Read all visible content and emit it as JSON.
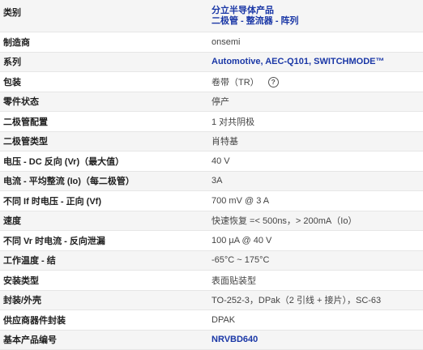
{
  "rows": [
    {
      "label": "类别",
      "value_lines": [
        "分立半导体产品",
        "二极管 - 整流器 - 阵列"
      ]
    },
    {
      "label": "制造商",
      "value": "onsemi"
    },
    {
      "label": "系列",
      "value": "Automotive, AEC-Q101, SWITCHMODE™"
    },
    {
      "label": "包装",
      "value": "卷带（TR）",
      "help_icon": "question-circle-icon",
      "help_glyph": "?"
    },
    {
      "label": "零件状态",
      "value": "停产"
    },
    {
      "label": "二极管配置",
      "value": "1 对共阴极"
    },
    {
      "label": "二极管类型",
      "value": "肖特基"
    },
    {
      "label": "电压 - DC 反向 (Vr)（最大值）",
      "value": "40 V"
    },
    {
      "label": "电流 - 平均整流 (Io)（每二极管）",
      "value": "3A"
    },
    {
      "label": "不同 If 时电压 - 正向 (Vf)",
      "value": "700 mV @ 3 A"
    },
    {
      "label": "速度",
      "value": "快速恢复 =< 500ns，> 200mA（Io）"
    },
    {
      "label": "不同 Vr 时电流 - 反向泄漏",
      "value": "100 µA @ 40 V"
    },
    {
      "label": "工作温度 - 结",
      "value": "-65°C ~ 175°C"
    },
    {
      "label": "安装类型",
      "value": "表面贴装型"
    },
    {
      "label": "封装/外壳",
      "value": "TO-252-3，DPak（2 引线 + 接片），SC-63"
    },
    {
      "label": "供应商器件封装",
      "value": "DPAK"
    },
    {
      "label": "基本产品编号",
      "value": "NRVBD640"
    }
  ],
  "colors": {
    "link": "#1a37a6",
    "row_shade": "#f5f5f5",
    "border": "#e6e6e6"
  }
}
